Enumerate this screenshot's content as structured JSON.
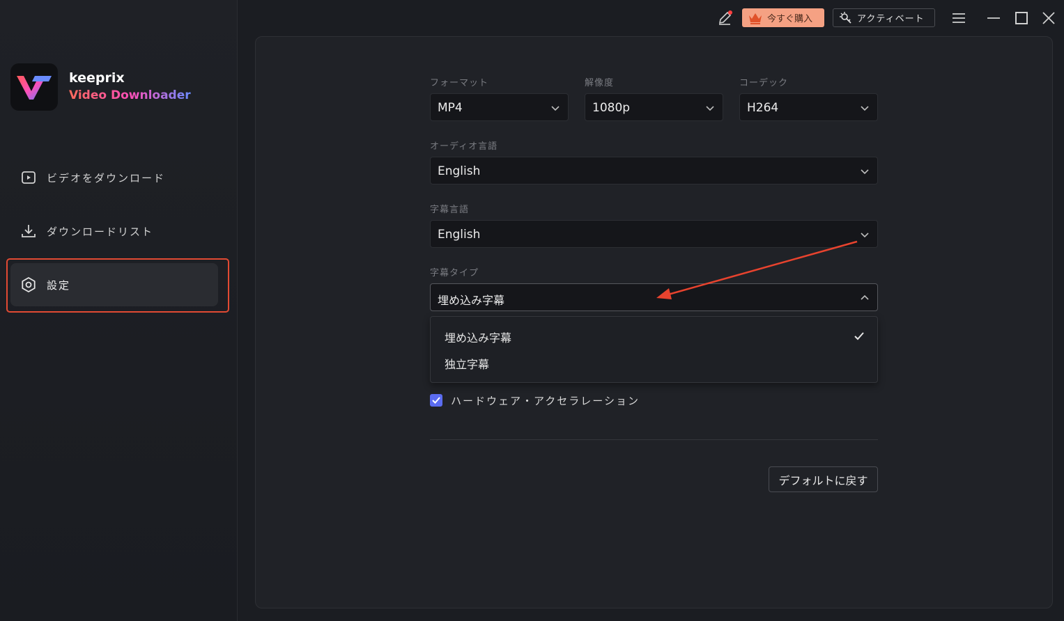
{
  "brand": {
    "name": "keeprix",
    "subtitle": "Video Downloader"
  },
  "sidebar": {
    "items": [
      {
        "label": "ビデオをダウンロード",
        "icon": "play-icon"
      },
      {
        "label": "ダウンロードリスト",
        "icon": "download-icon"
      },
      {
        "label": "設定",
        "icon": "gear-icon",
        "active": true
      }
    ]
  },
  "topbar": {
    "buy_label": "今すぐ購入",
    "activate_label": "アクティベート"
  },
  "settings": {
    "format": {
      "label": "フォーマット",
      "value": "MP4"
    },
    "resolution": {
      "label": "解像度",
      "value": "1080p"
    },
    "codec": {
      "label": "コーデック",
      "value": "H264"
    },
    "audio_language": {
      "label": "オーディオ言語",
      "value": "English"
    },
    "subtitle_language": {
      "label": "字幕言語",
      "value": "English"
    },
    "subtitle_type": {
      "label": "字幕タイプ",
      "value": "埋め込み字幕",
      "options": [
        "埋め込み字幕",
        "独立字幕"
      ],
      "selected_index": 0
    },
    "hardware_acceleration": {
      "label": "ハードウェア・アクセラレーション",
      "checked": true
    },
    "reset_label": "デフォルトに戻す"
  },
  "colors": {
    "accent": "#5b6cf0",
    "buy_button": "#f5a183",
    "highlight": "#e24a33"
  }
}
